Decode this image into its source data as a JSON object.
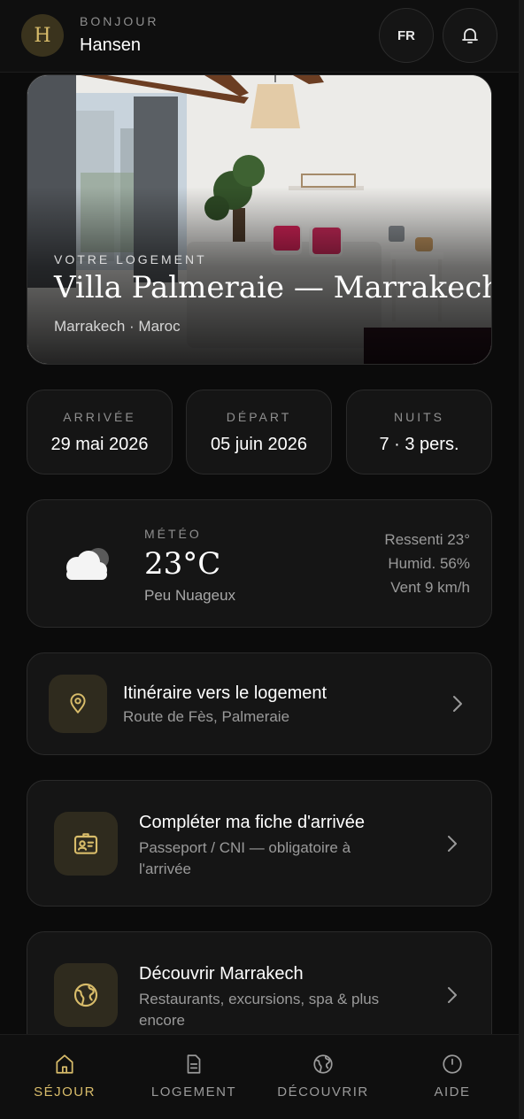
{
  "colors": {
    "accent": "#d8bc6a",
    "background": "#0b0b0b",
    "card": "#151515"
  },
  "header": {
    "avatar_letter": "H",
    "greeting": "BONJOUR",
    "name": "Hansen",
    "lang_label": "FR",
    "bell_icon": "bell-icon"
  },
  "hero": {
    "kicker": "VOTRE LOGEMENT",
    "title": "Villa Palmeraie — Marrakech",
    "location": "Marrakech · Maroc"
  },
  "stats": [
    {
      "label": "ARRIVÉE",
      "value": "29 mai 2026"
    },
    {
      "label": "DÉPART",
      "value": "05 juin 2026"
    },
    {
      "label": "NUITS",
      "value": "7 · 3 pers."
    }
  ],
  "weather": {
    "icon": "cloud-icon",
    "label": "MÉTÉO",
    "temp": "23°C",
    "description": "Peu Nuageux",
    "feels": "Ressenti 23°",
    "humidity": "Humid. 56%",
    "wind": "Vent 9 km/h"
  },
  "actions": [
    {
      "icon": "map-pin-icon",
      "title": "Itinéraire vers le logement",
      "subtitle": "Route de Fès, Palmeraie"
    },
    {
      "icon": "id-card-icon",
      "title": "Compléter ma fiche d'arrivée",
      "subtitle_line1": "Passeport / CNI — obligatoire à",
      "subtitle_line2": "l'arrivée"
    },
    {
      "icon": "globe-icon",
      "title": "Découvrir Marrakech",
      "subtitle_line1": "Restaurants, excursions, spa & plus",
      "subtitle_line2": "encore"
    }
  ],
  "tabs": [
    {
      "label": "SÉJOUR",
      "icon": "home-icon",
      "active": true
    },
    {
      "label": "LOGEMENT",
      "icon": "document-icon",
      "active": false
    },
    {
      "label": "DÉCOUVRIR",
      "icon": "globe-icon",
      "active": false
    },
    {
      "label": "AIDE",
      "icon": "clock-icon",
      "active": false
    }
  ]
}
